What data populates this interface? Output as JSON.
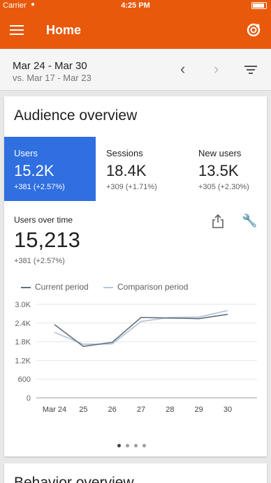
{
  "status_bar": {
    "carrier": "Carrier",
    "time": "4:25 PM"
  },
  "app_bar": {
    "title": "Home"
  },
  "date_range": {
    "current": "Mar 24 - Mar 30",
    "comparison": "vs. Mar 17 - Mar 23",
    "prev_glyph": "‹",
    "next_glyph": "›"
  },
  "card": {
    "title": "Audience overview",
    "metrics": [
      {
        "label": "Users",
        "value": "15.2K",
        "delta": "+381 (+2.57%)"
      },
      {
        "label": "Sessions",
        "value": "18.4K",
        "delta": "+309 (+1.71%)"
      },
      {
        "label": "New users",
        "value": "13.5K",
        "delta": "+305 (+2.30%)"
      }
    ],
    "users_over_time": {
      "label": "Users over time",
      "value": "15,213",
      "delta": "+381 (+2.57%)"
    },
    "legend": {
      "current": "Current period",
      "comparison": "Comparison period"
    },
    "dots": {
      "count": 4,
      "active": 0
    }
  },
  "colors": {
    "brand": "#e8590c",
    "active_tile": "#2f6fe0",
    "current_line": "#5f6f82",
    "comparison_line": "#b7c7d4"
  },
  "chart_data": {
    "type": "line",
    "categories": [
      "Mar 24",
      "25",
      "26",
      "27",
      "28",
      "29",
      "30"
    ],
    "series": [
      {
        "name": "Current period",
        "values": [
          2350,
          1650,
          1780,
          2580,
          2560,
          2540,
          2680
        ]
      },
      {
        "name": "Comparison period",
        "values": [
          2100,
          1720,
          1730,
          2450,
          2580,
          2590,
          2800
        ]
      }
    ],
    "yticks": [
      "0",
      "600",
      "1.2K",
      "1.8K",
      "2.4K",
      "3.0K"
    ],
    "ylim": [
      0,
      3000
    ],
    "grid": true
  },
  "next_card": {
    "title": "Behavior overview"
  }
}
